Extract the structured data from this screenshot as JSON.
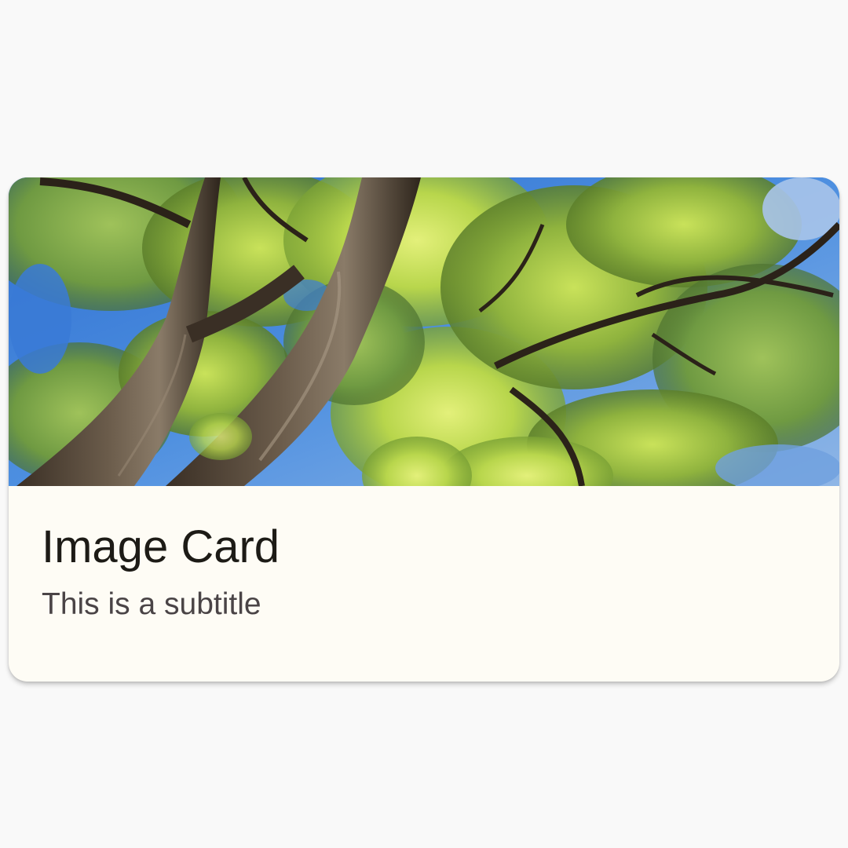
{
  "card": {
    "title": "Image Card",
    "subtitle": "This is a subtitle",
    "image_icon": "tree-canopy-photo",
    "colors": {
      "background": "#f9f9f9",
      "card_surface": "#fefcf5",
      "title_text": "#1d1b16",
      "subtitle_text": "#4a4446"
    }
  }
}
